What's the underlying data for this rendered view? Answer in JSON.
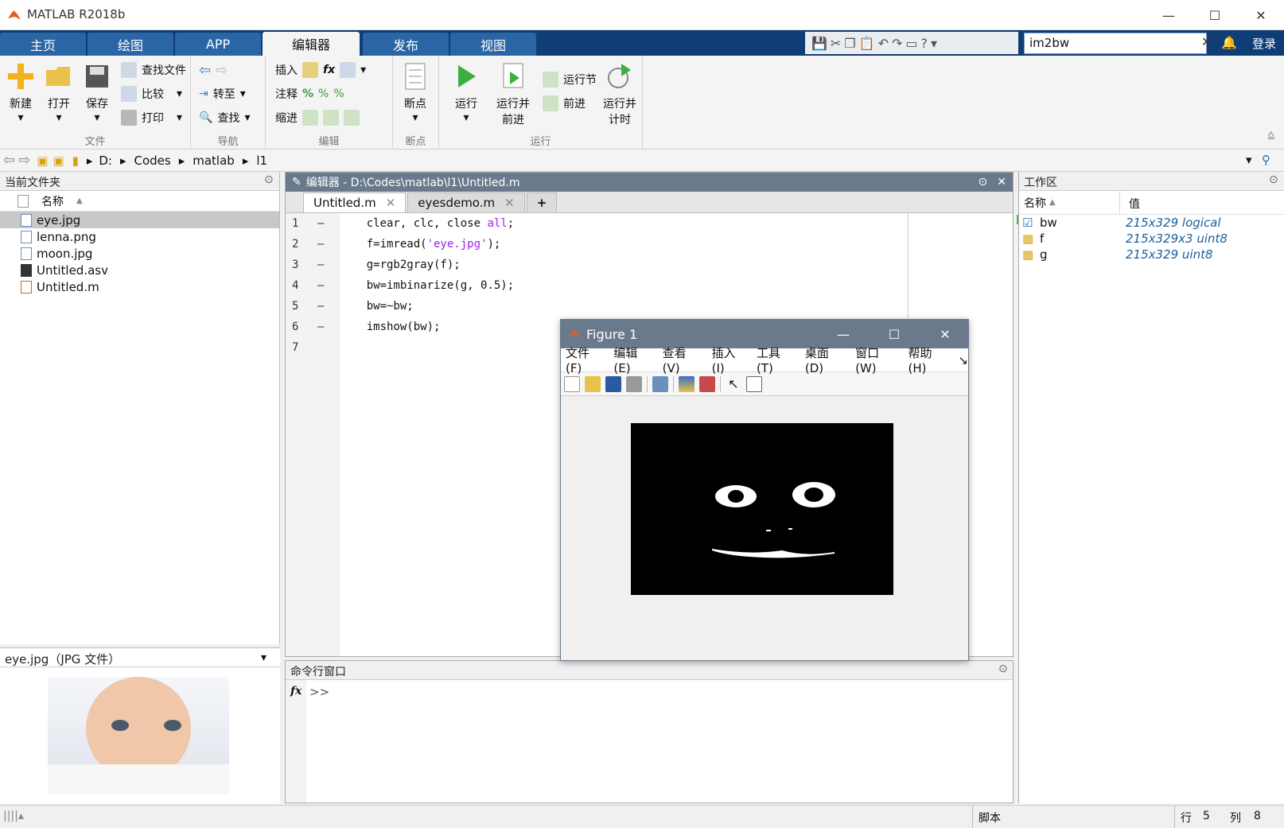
{
  "app": {
    "title": "MATLAB R2018b"
  },
  "ribbon_tabs": [
    "主页",
    "绘图",
    "APP",
    "编辑器",
    "发布",
    "视图"
  ],
  "search": {
    "value": "im2bw"
  },
  "login_label": "登录",
  "ribbon": {
    "file": {
      "label": "文件",
      "new": "新建",
      "open": "打开",
      "save": "保存",
      "find_file": "查找文件",
      "compare": "比较",
      "print": "打印"
    },
    "nav": {
      "label": "导航",
      "goto": "转至",
      "find": "查找"
    },
    "edit": {
      "label": "编辑",
      "insert": "插入",
      "comment": "注释",
      "indent": "缩进"
    },
    "breakpoints": {
      "label": "断点",
      "btn": "断点"
    },
    "run": {
      "label": "运行",
      "run": "运行",
      "run_advance_1": "运行并",
      "run_advance_2": "前进",
      "run_section": "运行节",
      "advance": "前进",
      "run_time_1": "运行并",
      "run_time_2": "计时"
    }
  },
  "address": {
    "parts": [
      "D:",
      "Codes",
      "matlab",
      "l1"
    ]
  },
  "current_folder": {
    "title": "当前文件夹",
    "col_name": "名称",
    "files": [
      {
        "name": "eye.jpg",
        "selected": true
      },
      {
        "name": "lenna.png"
      },
      {
        "name": "moon.jpg"
      },
      {
        "name": "Untitled.asv"
      },
      {
        "name": "Untitled.m"
      }
    ]
  },
  "preview": {
    "title": "eye.jpg（JPG 文件）"
  },
  "editor": {
    "title": "编辑器 - D:\\Codes\\matlab\\l1\\Untitled.m",
    "tabs": [
      "Untitled.m",
      "eyesdemo.m"
    ],
    "lines": [
      {
        "n": "1",
        "pre": "    clear, clc, close ",
        "str": "all",
        "post": ";"
      },
      {
        "n": "2",
        "pre": "    f=imread(",
        "str": "'eye.jpg'",
        "post": ");"
      },
      {
        "n": "3",
        "pre": "    g=rgb2gray(f);",
        "str": "",
        "post": ""
      },
      {
        "n": "4",
        "pre": "    bw=imbinarize(g, 0.5);",
        "str": "",
        "post": ""
      },
      {
        "n": "5",
        "pre": "    bw=~bw;",
        "str": "",
        "post": ""
      },
      {
        "n": "6",
        "pre": "    imshow(bw);",
        "str": "",
        "post": ""
      },
      {
        "n": "7",
        "pre": "",
        "str": "",
        "post": ""
      }
    ]
  },
  "command_window": {
    "title": "命令行窗口",
    "prompt": ">>"
  },
  "workspace": {
    "title": "工作区",
    "col_name": "名称",
    "col_value": "值",
    "vars": [
      {
        "name": "bw",
        "value": "215x329 logical"
      },
      {
        "name": "f",
        "value": "215x329x3 uint8"
      },
      {
        "name": "g",
        "value": "215x329 uint8"
      }
    ]
  },
  "figure": {
    "title": "Figure 1",
    "menus": [
      "文件(F)",
      "编辑(E)",
      "查看(V)",
      "插入(I)",
      "工具(T)",
      "桌面(D)",
      "窗口(W)",
      "帮助(H)"
    ]
  },
  "status": {
    "mode": "脚本",
    "row_label": "行",
    "row": "5",
    "col_label": "列",
    "col": "8"
  },
  "colors": {
    "tabbar": "#0f3d75",
    "tab": "#2a66a6",
    "string": "#a020f0",
    "ws_value": "#1b5e9c"
  }
}
